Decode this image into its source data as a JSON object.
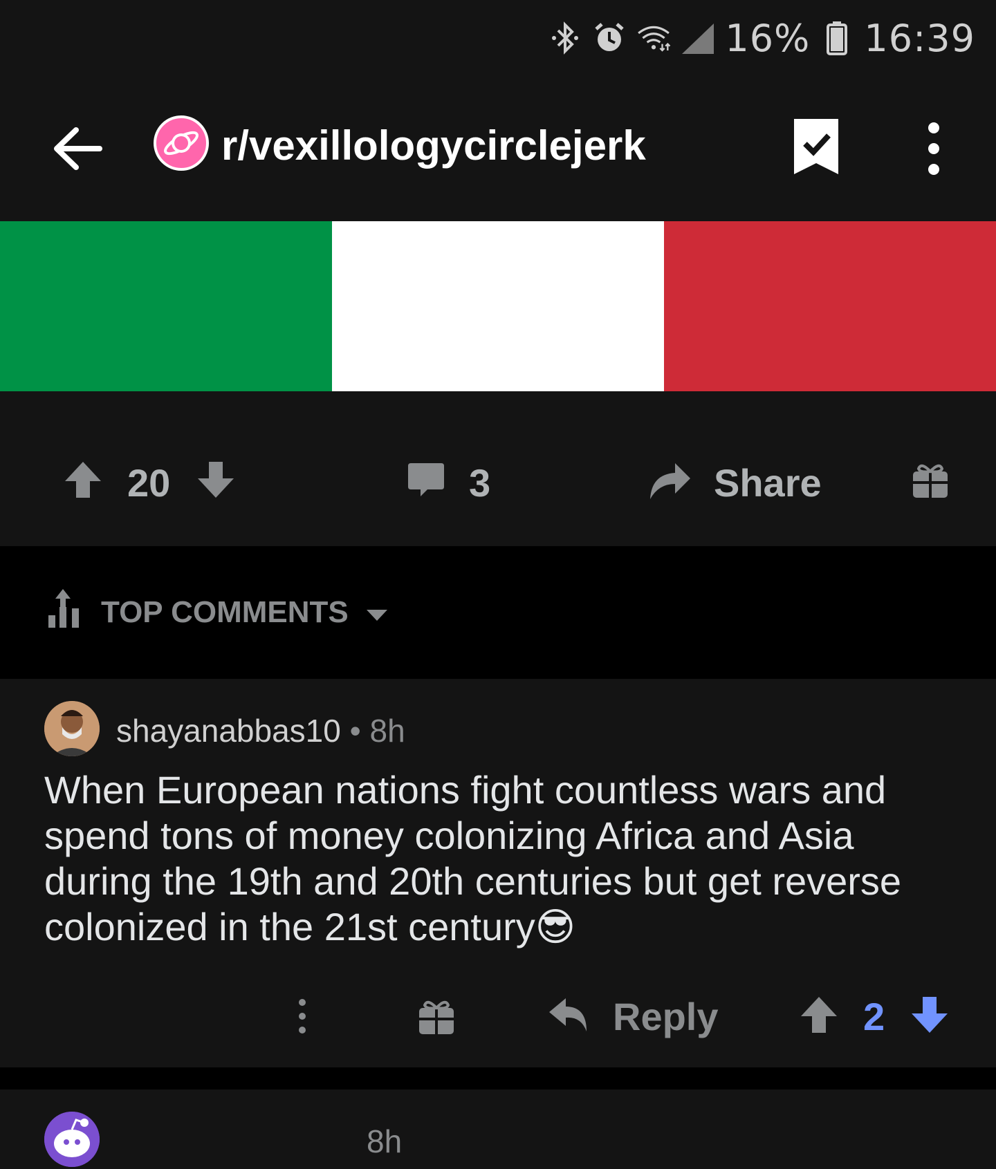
{
  "status_bar": {
    "battery": "16%",
    "time": "16:39",
    "icons": [
      "bluetooth-icon",
      "alarm-icon",
      "wifi-icon",
      "signal-icon",
      "battery-icon"
    ]
  },
  "header": {
    "subreddit": "r/vexillologycirclejerk",
    "icons": [
      "back-arrow-icon",
      "subreddit-icon",
      "saved-bookmark-icon",
      "more-vert-icon"
    ]
  },
  "post": {
    "flag_colors": [
      "#009246",
      "#ffffff",
      "#ce2b37"
    ],
    "score": "20",
    "comment_count": "3",
    "share_label": "Share"
  },
  "sort": {
    "label": "TOP COMMENTS"
  },
  "comments": [
    {
      "author": "shayanabbas10",
      "separator": "•",
      "age": "8h",
      "text": "When European nations fight countless wars and spend tons of money colonizing Africa and Asia during the 19th and 20th centuries but get reverse colonized in the 21st century😎",
      "reply_label": "Reply",
      "score": "2",
      "vote_state": "downvoted"
    },
    {
      "author": "",
      "age": "8h"
    }
  ],
  "colors": {
    "background": "#141414",
    "divider": "#000000",
    "downvote_blue": "#7193ff",
    "subreddit_pink": "#ff66ac"
  }
}
